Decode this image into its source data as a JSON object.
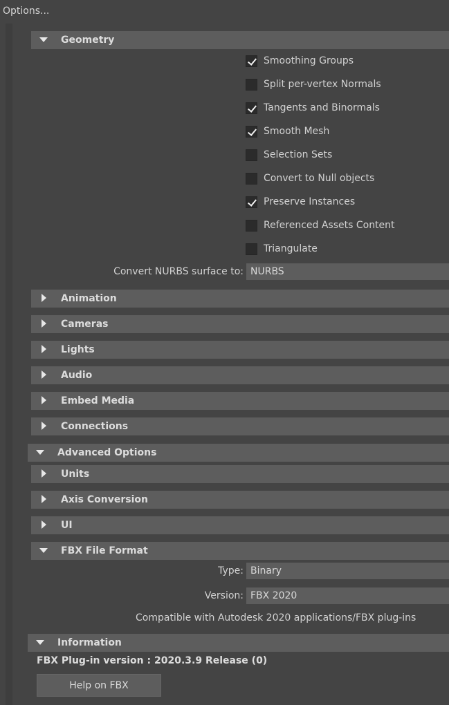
{
  "window": {
    "title": "Options..."
  },
  "geometry": {
    "label": "Geometry",
    "options": [
      {
        "label": "Smoothing Groups",
        "checked": true
      },
      {
        "label": "Split per-vertex Normals",
        "checked": false
      },
      {
        "label": "Tangents and Binormals",
        "checked": true
      },
      {
        "label": "Smooth Mesh",
        "checked": true
      },
      {
        "label": "Selection Sets",
        "checked": false
      },
      {
        "label": "Convert to Null objects",
        "checked": false
      },
      {
        "label": "Preserve Instances",
        "checked": true
      },
      {
        "label": "Referenced Assets Content",
        "checked": false
      },
      {
        "label": "Triangulate",
        "checked": false
      }
    ],
    "nurbs_label": "Convert NURBS surface to:",
    "nurbs_value": "NURBS"
  },
  "sections": {
    "animation": "Animation",
    "cameras": "Cameras",
    "lights": "Lights",
    "audio": "Audio",
    "embed_media": "Embed Media",
    "connections": "Connections"
  },
  "advanced": {
    "label": "Advanced Options",
    "units": "Units",
    "axis_conversion": "Axis Conversion",
    "ui": "UI",
    "fbx_file_format": {
      "label": "FBX File Format",
      "type_label": "Type:",
      "type_value": "Binary",
      "version_label": "Version:",
      "version_value": "FBX 2020",
      "note": "Compatible with Autodesk 2020 applications/FBX plug-ins"
    }
  },
  "information": {
    "label": "Information",
    "plugin_version": "FBX Plug-in version :  2020.3.9 Release (0)",
    "help_button": "Help on FBX"
  }
}
